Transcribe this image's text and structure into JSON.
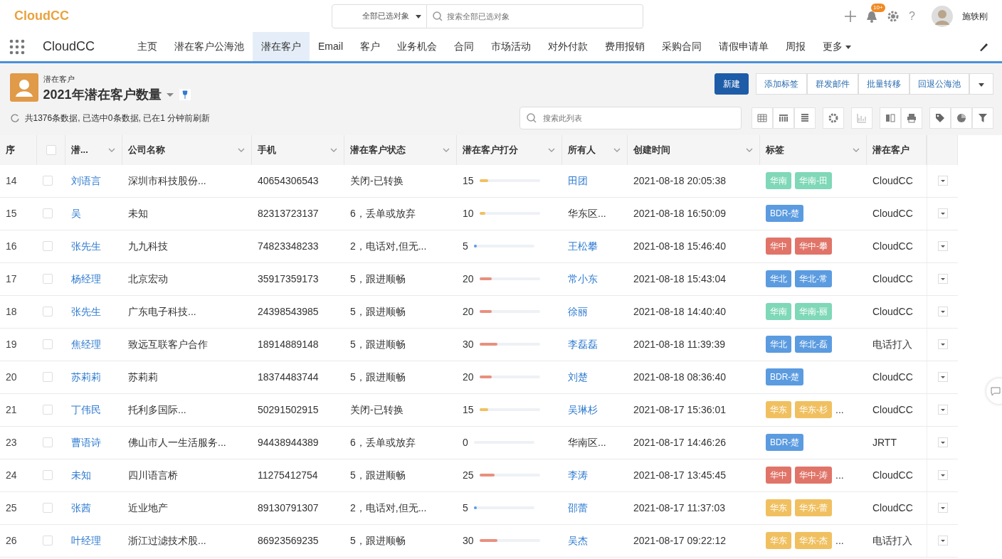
{
  "brand": {
    "logo": "CloudCC",
    "app_name": "CloudCC"
  },
  "global_search": {
    "scope": "全部已选对象",
    "placeholder": "搜索全部已选对象"
  },
  "user": {
    "notification_badge": "10+",
    "help": "?",
    "name": "施轶刚"
  },
  "nav_tabs": [
    {
      "label": "主页",
      "selected": false
    },
    {
      "label": "潜在客户公海池",
      "selected": false
    },
    {
      "label": "潜在客户",
      "selected": true
    },
    {
      "label": "Email",
      "selected": false
    },
    {
      "label": "客户",
      "selected": false
    },
    {
      "label": "业务机会",
      "selected": false
    },
    {
      "label": "合同",
      "selected": false
    },
    {
      "label": "市场活动",
      "selected": false
    },
    {
      "label": "对外付款",
      "selected": false
    },
    {
      "label": "费用报销",
      "selected": false
    },
    {
      "label": "采购合同",
      "selected": false
    },
    {
      "label": "请假申请单",
      "selected": false
    },
    {
      "label": "周报",
      "selected": false
    },
    {
      "label": "更多",
      "selected": false
    }
  ],
  "list_header": {
    "object": "潜在客户",
    "view_name": "2021年潜在客户数量",
    "summary": "共1376条数据, 已选中0条数据, 已在1 分钟前刷新",
    "search_placeholder": "搜索此列表"
  },
  "actions": [
    {
      "label": "新建",
      "primary": true
    },
    {
      "label": "添加标签",
      "primary": false
    },
    {
      "label": "群发邮件",
      "primary": false
    },
    {
      "label": "批量转移",
      "primary": false
    },
    {
      "label": "回退公海池",
      "primary": false
    }
  ],
  "table": {
    "select_all_checked": false,
    "columns": [
      "序",
      "潜...",
      "公司名称",
      "手机",
      "潜在客户状态",
      "潜在客户打分",
      "所有人",
      "创建时间",
      "标签",
      "潜在客户"
    ],
    "rows": [
      {
        "index": "14",
        "checked": false,
        "name": "刘语言",
        "company": "深圳市科技股份...",
        "phone": "40654306543",
        "status": "关闭-已转换",
        "score": "15",
        "level": 0.15,
        "owner": "田团",
        "owner_link": true,
        "created": "2021-08-18 20:05:38",
        "tags": [
          {
            "text": "华南",
            "color": "#7fd8b8"
          },
          {
            "text": "华南-田",
            "color": "#7fd8b8"
          }
        ],
        "more": false,
        "source": "CloudCC"
      },
      {
        "index": "15",
        "checked": false,
        "name": "吴",
        "company": "未知",
        "phone": "82313723137",
        "status": "6，丢单或放弃",
        "score": "10",
        "level": 0.1,
        "owner": "华东区...",
        "owner_link": false,
        "created": "2021-08-18 16:50:09",
        "tags": [
          {
            "text": "BDR-楚",
            "color": "#5b9be0"
          }
        ],
        "more": false,
        "source": "CloudCC"
      },
      {
        "index": "16",
        "checked": false,
        "name": "张先生",
        "company": "九九科技",
        "phone": "74823348233",
        "status": "2，电话对,但无...",
        "score": "5",
        "level": 0.05,
        "owner": "王松攀",
        "owner_link": true,
        "created": "2021-08-18 15:46:40",
        "tags": [
          {
            "text": "华中",
            "color": "#e07468"
          },
          {
            "text": "华中-攀",
            "color": "#e07468"
          }
        ],
        "more": false,
        "source": "CloudCC"
      },
      {
        "index": "17",
        "checked": false,
        "name": "杨经理",
        "company": "北京宏动",
        "phone": "35917359173",
        "status": "5，跟进顺畅",
        "score": "20",
        "level": 0.2,
        "owner": "常小东",
        "owner_link": true,
        "created": "2021-08-18 15:43:04",
        "tags": [
          {
            "text": "华北",
            "color": "#5b9be0"
          },
          {
            "text": "华北-常",
            "color": "#5b9be0"
          }
        ],
        "more": false,
        "source": "CloudCC"
      },
      {
        "index": "18",
        "checked": false,
        "name": "张先生",
        "company": "广东电子科技...",
        "phone": "24398543985",
        "status": "5，跟进顺畅",
        "score": "20",
        "level": 0.2,
        "owner": "徐丽",
        "owner_link": true,
        "created": "2021-08-18 14:40:40",
        "tags": [
          {
            "text": "华南",
            "color": "#7fd8b8"
          },
          {
            "text": "华南-丽",
            "color": "#7fd8b8"
          }
        ],
        "more": false,
        "source": "CloudCC"
      },
      {
        "index": "19",
        "checked": false,
        "name": "焦经理",
        "company": "致远互联客户合作",
        "phone": "18914889148",
        "status": "5，跟进顺畅",
        "score": "30",
        "level": 0.3,
        "owner": "李磊磊",
        "owner_link": true,
        "created": "2021-08-18 11:39:39",
        "tags": [
          {
            "text": "华北",
            "color": "#5b9be0"
          },
          {
            "text": "华北-磊",
            "color": "#5b9be0"
          }
        ],
        "more": false,
        "source": "电话打入"
      },
      {
        "index": "20",
        "checked": false,
        "name": "苏莉莉",
        "company": "苏莉莉",
        "phone": "18374483744",
        "status": "5，跟进顺畅",
        "score": "20",
        "level": 0.2,
        "owner": "刘楚",
        "owner_link": true,
        "created": "2021-08-18 08:36:40",
        "tags": [
          {
            "text": "BDR-楚",
            "color": "#5b9be0"
          }
        ],
        "more": false,
        "source": "CloudCC"
      },
      {
        "index": "21",
        "checked": false,
        "name": "丁伟民",
        "company": "托利多国际...",
        "phone": "50291502915",
        "status": "关闭-已转换",
        "score": "15",
        "level": 0.15,
        "owner": "吴琳杉",
        "owner_link": true,
        "created": "2021-08-17 15:36:01",
        "tags": [
          {
            "text": "华东",
            "color": "#f0c060"
          },
          {
            "text": "华东-杉",
            "color": "#f0c060"
          }
        ],
        "more": true,
        "source": "CloudCC"
      },
      {
        "index": "23",
        "checked": false,
        "name": "曹语诗",
        "company": "佛山市人一生活服务...",
        "phone": "94438944389",
        "status": "6，丢单或放弃",
        "score": "0",
        "level": 0,
        "owner": "华南区...",
        "owner_link": false,
        "created": "2021-08-17 14:46:26",
        "tags": [
          {
            "text": "BDR-楚",
            "color": "#5b9be0"
          }
        ],
        "more": false,
        "source": "JRTT"
      },
      {
        "index": "24",
        "checked": false,
        "name": "未知",
        "company": "四川语言桥",
        "phone": "11275412754",
        "status": "5，跟进顺畅",
        "score": "25",
        "level": 0.25,
        "owner": "李涛",
        "owner_link": true,
        "created": "2021-08-17 13:45:45",
        "tags": [
          {
            "text": "华中",
            "color": "#e07468"
          },
          {
            "text": "华中-涛",
            "color": "#e07468"
          }
        ],
        "more": true,
        "source": "CloudCC"
      },
      {
        "index": "25",
        "checked": false,
        "name": "张茜",
        "company": "近业地产",
        "phone": "89130791307",
        "status": "2，电话对,但无...",
        "score": "5",
        "level": 0.05,
        "owner": "邵蕾",
        "owner_link": true,
        "created": "2021-08-17 11:37:03",
        "tags": [
          {
            "text": "华东",
            "color": "#f0c060"
          },
          {
            "text": "华东-蕾",
            "color": "#f0c060"
          }
        ],
        "more": false,
        "source": "CloudCC"
      },
      {
        "index": "26",
        "checked": false,
        "name": "叶经理",
        "company": "浙江过滤技术股...",
        "phone": "86923569235",
        "status": "5，跟进顺畅",
        "score": "30",
        "level": 0.3,
        "owner": "吴杰",
        "owner_link": true,
        "created": "2021-08-17 09:22:12",
        "tags": [
          {
            "text": "华东",
            "color": "#f0c060"
          },
          {
            "text": "华东-杰",
            "color": "#f0c060"
          }
        ],
        "more": true,
        "source": "电话打入"
      }
    ]
  },
  "more_marker": "..."
}
